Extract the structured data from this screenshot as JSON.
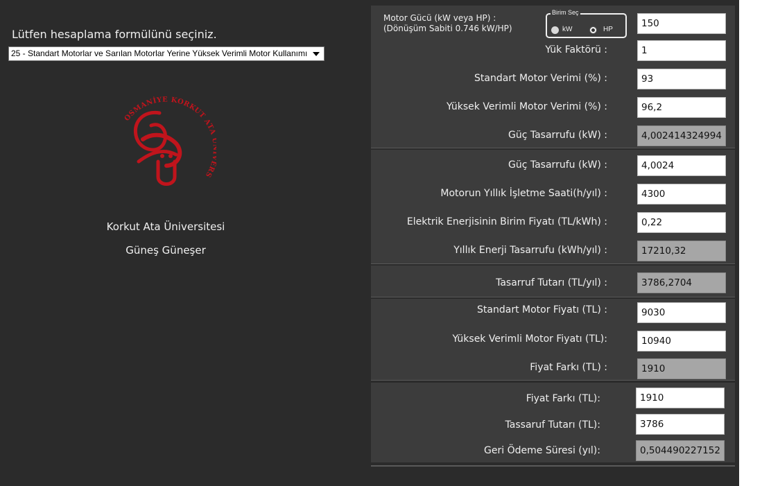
{
  "left": {
    "prompt": "Lütfen hesaplama formülünü seçiniz.",
    "formula_selected": "25 - Standart Motorlar ve Sarılan Motorlar Yerine Yüksek Verimli Motor Kullanımı",
    "logo_text": "OSMANİYE KORKUT ATA ÜNİVERSİTESİ",
    "university": "Korkut Ata Üniversitesi",
    "author": "Güneş Güneşer"
  },
  "motor": {
    "label_line1": "Motor Gücü (kW veya HP) :",
    "label_line2": "(Dönüşüm Sabiti 0.746 kW/HP)",
    "unit_legend": "Birim Seç",
    "unit_kw": "kW",
    "unit_hp": "HP",
    "selected_unit": "HP",
    "power_value": "150"
  },
  "section1": {
    "load_factor_label": "Yük Faktörü :",
    "load_factor_value": "1",
    "std_eff_label": "Standart Motor Verimi (%) :",
    "std_eff_value": "93",
    "high_eff_label": "Yüksek Verimli Motor Verimi (%) :",
    "high_eff_value": "96,2",
    "power_saving_label": "Güç Tasarrufu (kW) :",
    "power_saving_value": "4,002414324994"
  },
  "section2": {
    "power_saving_label": "Güç Tasarrufu (kW) :",
    "power_saving_value": "4,0024",
    "hours_label": "Motorun Yıllık İşletme Saati(h/yıl) :",
    "hours_value": "4300",
    "price_label": "Elektrik Enerjisinin Birim Fiyatı (TL/kWh) :",
    "price_value": "0,22",
    "energy_saving_label": "Yıllık Enerji Tasarrufu (kWh/yıl) :",
    "energy_saving_value": "17210,32"
  },
  "section3": {
    "saving_amount_label": "Tasarruf Tutarı (TL/yıl) :",
    "saving_amount_value": "3786,2704"
  },
  "section4": {
    "std_price_label": "Standart Motor Fiyatı (TL) :",
    "std_price_value": "9030",
    "high_price_label": "Yüksek Verimli Motor Fiyatı (TL):",
    "high_price_value": "10940",
    "price_diff_label": "Fiyat Farkı (TL) :",
    "price_diff_value": "1910"
  },
  "section5": {
    "price_diff_label": "Fiyat Farkı (TL):",
    "price_diff_value": "1910",
    "saving_label": "Tassaruf Tutarı (TL):",
    "saving_value": "3786",
    "payback_label": "Geri Ödeme Süresi (yıl):",
    "payback_value": "0,504490227152"
  },
  "colors": {
    "app_bg": "#2b2b2b",
    "panel_bg": "#3c3c3c",
    "readonly_field": "#a6a6a6",
    "logo_red": "#c0141c"
  }
}
